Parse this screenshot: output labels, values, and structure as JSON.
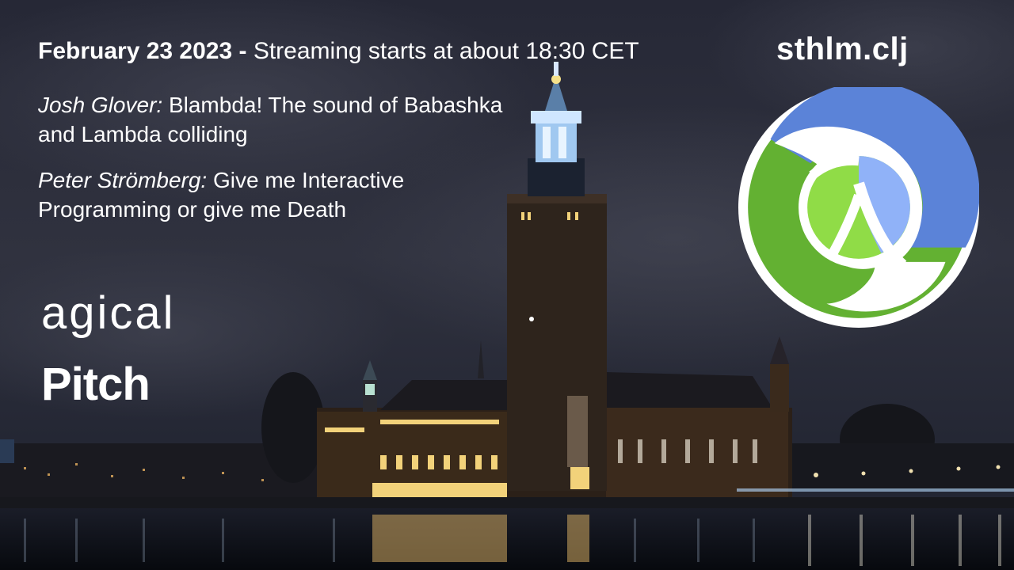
{
  "header": {
    "date": "February 23 2023 -",
    "streaming": "Streaming starts at about 18:30 CET"
  },
  "brand": {
    "name": "sthlm.clj",
    "logo_icon": "clojure-logo-icon",
    "colors": {
      "blue": "#5b83d8",
      "light_blue": "#90b2f8",
      "green": "#63b132",
      "light_green": "#90dc47"
    }
  },
  "talks": [
    {
      "speaker": "Josh Glover:",
      "title": "Blambda! The sound of Babashka and Lambda colliding"
    },
    {
      "speaker": "Peter Strömberg:",
      "title": "Give me Interactive Programming or give me Death"
    }
  ],
  "sponsors": [
    "agical",
    "Pitch"
  ],
  "background": {
    "subject": "Stockholm City Hall at night",
    "sky": "#2a2d3c",
    "water": "#0c1018"
  }
}
